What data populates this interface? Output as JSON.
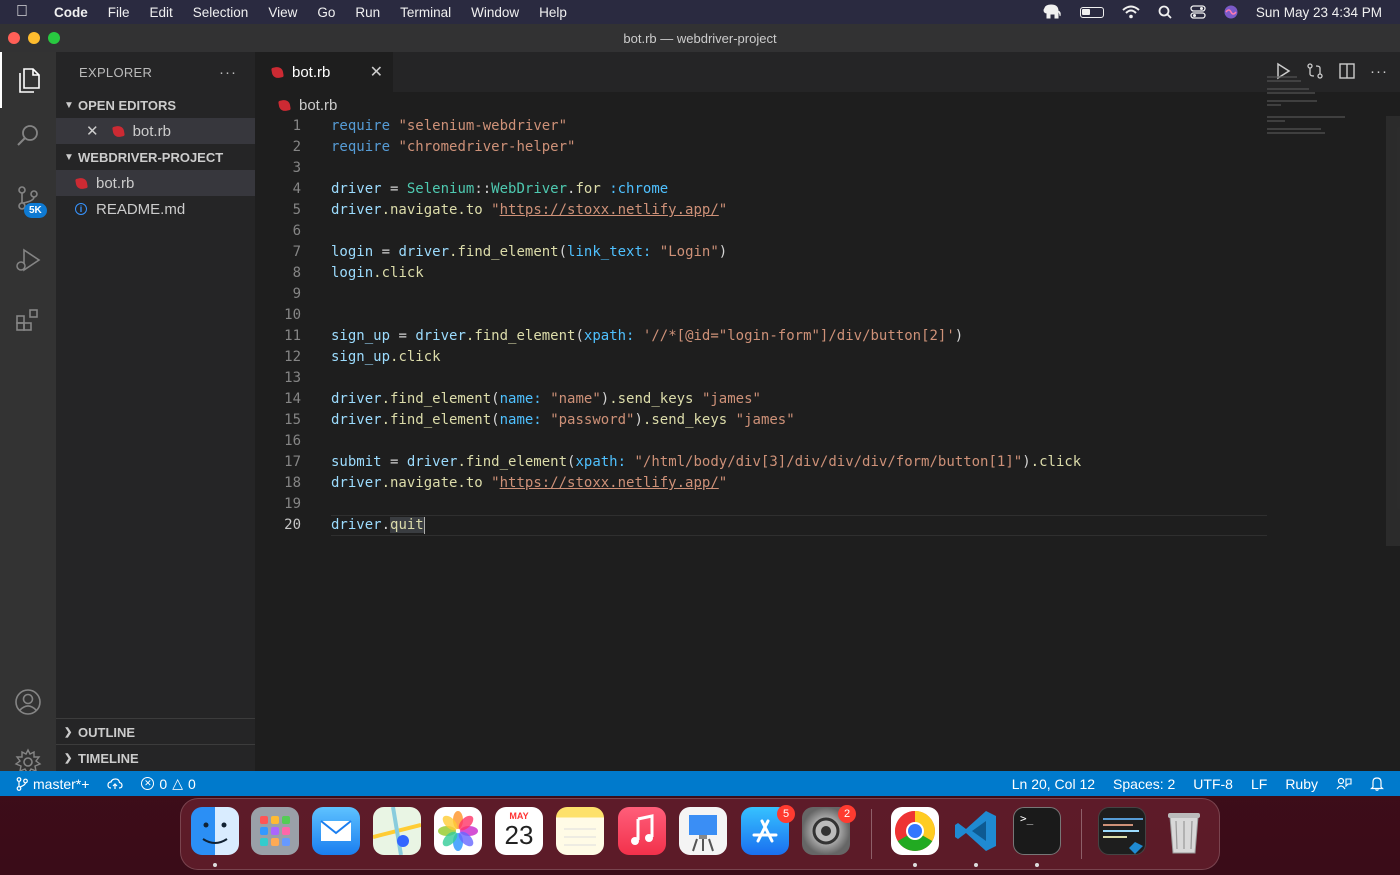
{
  "menubar": {
    "app_name": "Code",
    "items": [
      "File",
      "Edit",
      "Selection",
      "View",
      "Go",
      "Run",
      "Terminal",
      "Window",
      "Help"
    ],
    "clock": "Sun May 23  4:34 PM"
  },
  "window": {
    "title": "bot.rb — webdriver-project"
  },
  "activity_bar": {
    "scm_badge": "5K"
  },
  "sidebar": {
    "header": "EXPLORER",
    "more": "···",
    "open_editors_label": "OPEN EDITORS",
    "open_editor_file": "bot.rb",
    "project_label": "WEBDRIVER-PROJECT",
    "files": [
      "bot.rb",
      "README.md"
    ],
    "outline_label": "OUTLINE",
    "timeline_label": "TIMELINE"
  },
  "editor": {
    "tab_label": "bot.rb",
    "breadcrumb": "bot.rb",
    "line_numbers": [
      "1",
      "2",
      "3",
      "4",
      "5",
      "6",
      "7",
      "8",
      "9",
      "10",
      "11",
      "12",
      "13",
      "14",
      "15",
      "16",
      "17",
      "18",
      "19",
      "20"
    ],
    "code": {
      "l1_kw": "require",
      "l1_str": "\"selenium-webdriver\"",
      "l2_kw": "require",
      "l2_str": "\"chromedriver-helper\"",
      "l4_var": "driver",
      "l4_eq": " = ",
      "l4_cls1": "Selenium",
      "l4_sep": "::",
      "l4_cls2": "WebDriver",
      "l4_dot": ".",
      "l4_meth": "for",
      "l4_sp": " ",
      "l4_sym": ":chrome",
      "l5_obj": "driver",
      "l5_meth": ".navigate.to",
      "l5_sp": " ",
      "l5_q1": "\"",
      "l5_url": "https://stoxx.netlify.app/",
      "l5_q2": "\"",
      "l7_var": "login",
      "l7_eq": " = ",
      "l7_obj": "driver",
      "l7_meth": ".find_element",
      "l7_p1": "(",
      "l7_key": "link_text:",
      "l7_sp": " ",
      "l7_str": "\"Login\"",
      "l7_p2": ")",
      "l8_obj": "login",
      "l8_meth": ".click",
      "l11_var": "sign_up",
      "l11_eq": " = ",
      "l11_obj": "driver",
      "l11_meth": ".find_element",
      "l11_p1": "(",
      "l11_key": "xpath:",
      "l11_sp": " ",
      "l11_str": "'//*[@id=\"login-form\"]/div/button[2]'",
      "l11_p2": ")",
      "l12_obj": "sign_up",
      "l12_meth": ".click",
      "l14_obj": "driver",
      "l14_meth": ".find_element",
      "l14_p1": "(",
      "l14_key": "name:",
      "l14_sp": " ",
      "l14_str": "\"name\"",
      "l14_p2": ")",
      "l14_meth2": ".send_keys",
      "l14_sp2": " ",
      "l14_str2": "\"james\"",
      "l15_obj": "driver",
      "l15_meth": ".find_element",
      "l15_p1": "(",
      "l15_key": "name:",
      "l15_sp": " ",
      "l15_str": "\"password\"",
      "l15_p2": ")",
      "l15_meth2": ".send_keys",
      "l15_sp2": " ",
      "l15_str2": "\"james\"",
      "l17_var": "submit",
      "l17_eq": " = ",
      "l17_obj": "driver",
      "l17_meth": ".find_element",
      "l17_p1": "(",
      "l17_key": "xpath:",
      "l17_sp": " ",
      "l17_str": "\"/html/body/div[3]/div/div/div/form/button[1]\"",
      "l17_p2": ")",
      "l17_meth2": ".click",
      "l18_obj": "driver",
      "l18_meth": ".navigate.to",
      "l18_sp": " ",
      "l18_q1": "\"",
      "l18_url": "https://stoxx.netlify.app/",
      "l18_q2": "\"",
      "l20_obj": "driver",
      "l20_dot": ".",
      "l20_meth": "quit"
    }
  },
  "statusbar": {
    "branch": "master*+",
    "errors": "0",
    "warnings": "0",
    "position": "Ln 20, Col 12",
    "spaces": "Spaces: 2",
    "encoding": "UTF-8",
    "eol": "LF",
    "language": "Ruby"
  },
  "dock": {
    "calendar_month": "MAY",
    "calendar_day": "23",
    "appstore_badge": "5",
    "settings_badge": "2",
    "terminal_prompt": ">_"
  }
}
